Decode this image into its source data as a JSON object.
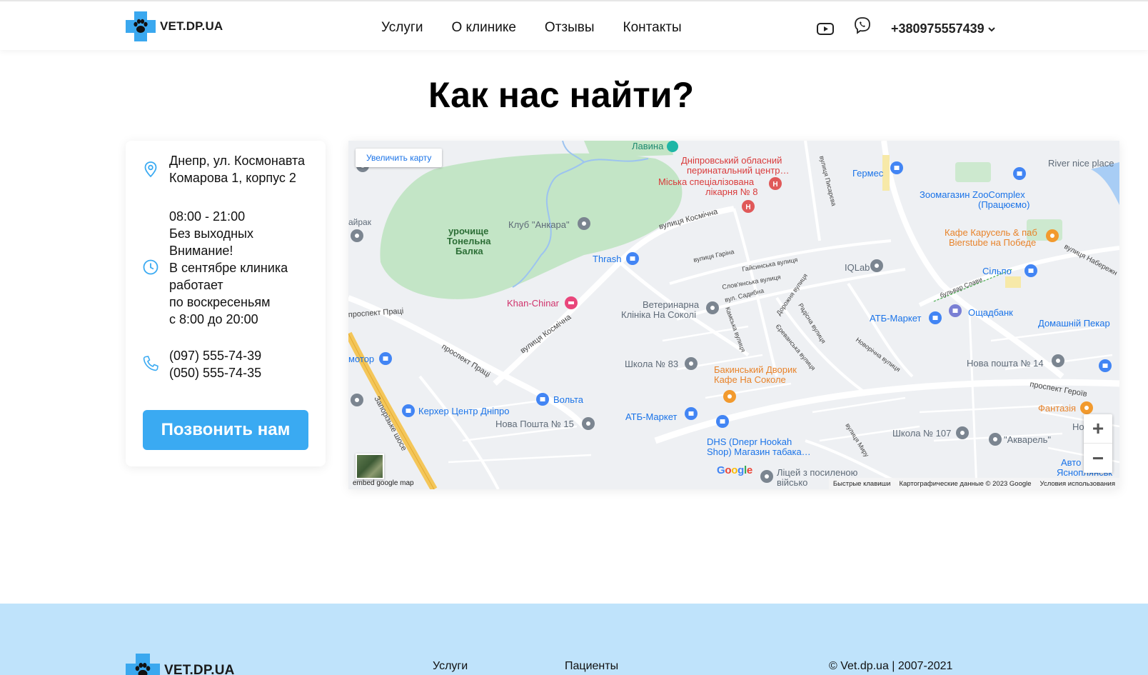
{
  "header": {
    "logo_text": "VET.DP.UA",
    "nav": [
      "Услуги",
      "О клинике",
      "Отзывы",
      "Контакты"
    ],
    "phone": "+380975557439"
  },
  "page_title": "Как нас найти?",
  "info_card": {
    "address_line1": "Днепр, ул. Космонавта",
    "address_line2": "Комарова 1, корпус 2",
    "hours": [
      "08:00 - 21:00",
      "Без выходных",
      "Внимание!",
      "В сентябре клиника",
      "работает",
      "по воскресеньям",
      "с 8:00 до 20:00"
    ],
    "phones": [
      "(097) 555-74-39",
      "(050) 555-74-35"
    ],
    "call_button": "Позвонить нам"
  },
  "map": {
    "enlarge_label": "Увеличить карту",
    "embed_label": "embed google map",
    "google_label": "Google",
    "footer_links": [
      "Быстрые клавиши",
      "Картографические данные © 2023 Google",
      "Условия использования"
    ],
    "zoom_in": "+",
    "zoom_out": "−",
    "labels": {
      "lavina": "Лавина",
      "hospital1_a": "Дніпровський обласний",
      "hospital1_b": "перинатальний центр…",
      "hospital2_a": "Міська спеціалізована",
      "hospital2_b": "лікарня № 8",
      "germes": "Гермес",
      "river": "River nice place",
      "zoo_a": "Зоомагазин ZooComplex",
      "zoo_b": "(Працюємо)",
      "cafe_a": "Кафе Карусель & паб",
      "cafe_b": "Bierstube на Победе",
      "ankara": "Клуб \"Анкара\"",
      "urochyshche_a": "урочище",
      "urochyshche_b": "Тонельна",
      "urochyshche_c": "Балка",
      "thrash": "Thrash",
      "iqlab": "IQLab",
      "silpo": "Сільпо",
      "khan": "Khan-Chinar",
      "vet_a": "Ветеринарна",
      "vet_b": "Клініка На Соколі",
      "atb1": "АТБ-Маркет",
      "oshchad": "Ощадбанк",
      "bakery": "Домашній Пекар",
      "motor": "мотор",
      "school83": "Школа № 83",
      "baku_a": "Бакинський Дворик",
      "baku_b": "Кафе На Соколе",
      "np14": "Нова пошта № 14",
      "kercher": "Керхер Центр Дніпро",
      "volta": "Вольта",
      "np15": "Нова Пошта № 15",
      "atb2": "АТБ-Маркет",
      "fantasia": "Фантазія",
      "school107": "Школа № 107",
      "akvarel": "\"Акварель\"",
      "nova": "Нова",
      "dhs_a": "DHS (Dnepr Hookah",
      "dhs_b": "Shop) Магазин табака…",
      "lyceum_a": "Ліцей з посиленою",
      "lyceum_b": "військо",
      "avto_a": "Авто",
      "avto_b": "Ясноплянськ",
      "street_kosmichna1": "вулиця Космічна",
      "street_kosmichna2": "вулиця Космічна",
      "street_pratsi1": "проспект Праці",
      "street_pratsi2": "проспект Праці",
      "street_zaporizke": "Запорізьке шосе",
      "street_geroiv": "проспект Героїв",
      "street_gaisinska": "Гайсинська вулиця",
      "street_slovianska": "Слов'янська вулиця",
      "street_sadybna": "вул. Садибна",
      "street_garina": "вулиця Гаріна",
      "street_dorozhnia": "Дорожня вулиця",
      "street_kamska": "Камська вулиця",
      "street_radisna": "Радісна вулиця",
      "street_yerevanska": "Єреванська вулиця",
      "street_novorichna": "Новорічна вулиця",
      "street_myru": "вулиця Миру",
      "street_pysarieva": "вулиця Писарєва",
      "street_naber": "вулиця Набережн",
      "street_bulvar": "бульвар Слави",
      "park_left": "айрак"
    }
  },
  "footer": {
    "logo_text": "VET.DP.UA",
    "link_services": "Услуги",
    "link_patients": "Пациенты",
    "copyright": "© Vet.dp.ua | 2007-2021"
  },
  "colors": {
    "accent": "#3aaaf2",
    "footer_bg": "#bfe3fb",
    "map_bg": "#eef0f3",
    "park": "#c3e5c6"
  }
}
